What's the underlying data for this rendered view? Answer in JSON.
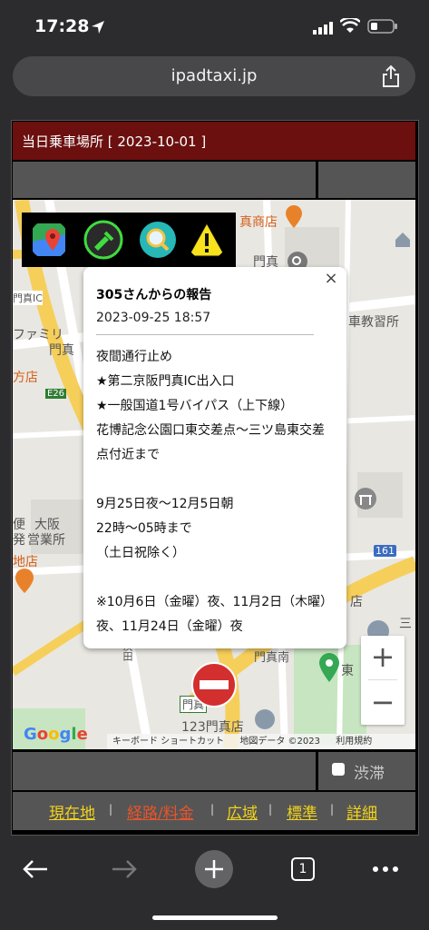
{
  "status_bar": {
    "time": "17:28"
  },
  "browser": {
    "url": "ipadtaxi.jp",
    "tab_count": "1"
  },
  "header": {
    "title": "当日乗車場所 [ 2023-10-01 ]",
    "bg_color": "#6b0f0f"
  },
  "map": {
    "labels": {
      "store": "真商店",
      "station": "門真",
      "ic": "門真IC",
      "famima": "ファミリ",
      "kadoma": "門真",
      "shop": "方店",
      "e26": "E26",
      "osaka": "大阪",
      "eigyosho": "営業所",
      "bin": "便",
      "sho": "発",
      "jidosha": "車教習所",
      "r161": "161",
      "minami": "門真南",
      "higashi": "東",
      "store2": "123門真店",
      "tennou": "店",
      "mitsu": "三",
      "rest": "地店",
      "shop3": "門真",
      "mi": "茨田"
    },
    "footer": {
      "shortcuts": "キーボード ショートカット",
      "data": "地図データ ©2023",
      "terms": "利用規約"
    },
    "google": "Google"
  },
  "popup": {
    "title": "305さんからの報告",
    "datetime": "2023-09-25 18:57",
    "body": "夜間通行止め\n★第二京阪門真IC出入口\n★一般国道1号バイパス（上下線）\n花博記念公園口東交差点～三ツ島東交差点付近まで\n\n9月25日夜～12月5日朝\n22時～05時まで\n（土日祝除く）\n\n※10月6日（金曜）夜、11月2日（木曜）夜、11月24日（金曜）夜"
  },
  "controls": {
    "zoom_in": "+",
    "zoom_out": "−",
    "traffic_label": "渋滞",
    "popup_close": "×"
  },
  "nav": {
    "items": [
      {
        "label": "現在地",
        "color": "#f2d31b"
      },
      {
        "label": "経路/料金",
        "color": "#e8542b"
      },
      {
        "label": "広域",
        "color": "#f2d31b"
      },
      {
        "label": "標準",
        "color": "#f2d31b"
      },
      {
        "label": "詳細",
        "color": "#f2d31b"
      }
    ],
    "separator": "|"
  },
  "icons": {
    "toolbar": [
      "map-pin-icon",
      "flashlight-icon",
      "search-icon",
      "warning-icon"
    ],
    "marker": "no-entry-icon"
  }
}
